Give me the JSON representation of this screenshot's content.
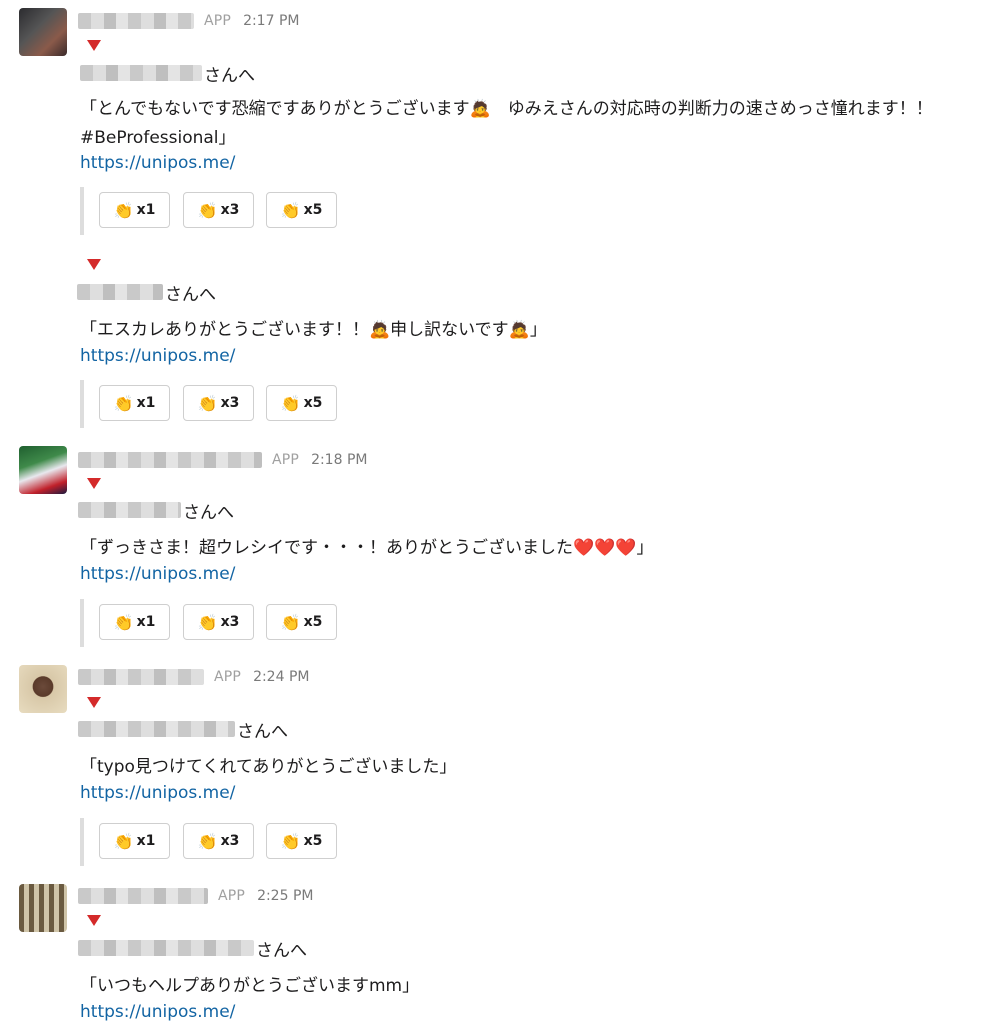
{
  "button_labels": [
    "x1",
    "x3",
    "x5"
  ],
  "clap_icon": "👏",
  "posts": [
    {
      "app": "APP",
      "time": "2:17 PM",
      "entries": [
        {
          "to": "さんへ",
          "text": "「とんでもないです恐縮ですありがとうございます🙇　ゆみえさんの対応時の判断力の速さめっさ憧れます！！ #BeProfessional」",
          "link": "https://unipos.me/"
        },
        {
          "to": "さんへ",
          "text": "「エスカレありがとうございます！！🙇申し訳ないです🙇」",
          "link": "https://unipos.me/"
        }
      ]
    },
    {
      "app": "APP",
      "time": "2:18 PM",
      "entries": [
        {
          "to": "さんへ",
          "text": "「ずっきさま！超ウレシイです・・・！ありがとうございました❤️❤️❤️」",
          "link": "https://unipos.me/"
        }
      ]
    },
    {
      "app": "APP",
      "time": "2:24 PM",
      "entries": [
        {
          "to": "さんへ",
          "text": "「typo見つけてくれてありがとうございました」",
          "link": "https://unipos.me/"
        }
      ]
    },
    {
      "app": "APP",
      "time": "2:25 PM",
      "entries": [
        {
          "to": "さんへ",
          "text": "「いつもヘルプありがとうございますmm」",
          "link": "https://unipos.me/"
        }
      ]
    }
  ]
}
